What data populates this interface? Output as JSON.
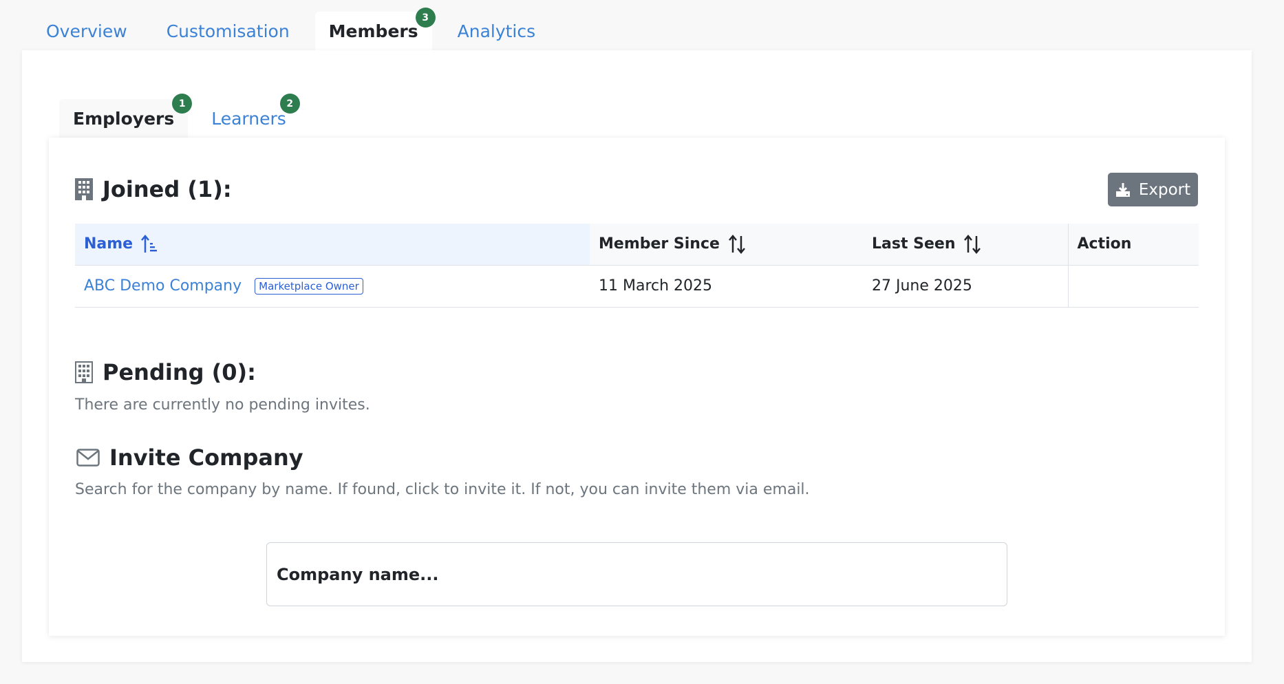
{
  "top_tabs": [
    {
      "label": "Overview"
    },
    {
      "label": "Customisation"
    },
    {
      "label": "Members",
      "badge": "3"
    },
    {
      "label": "Analytics"
    }
  ],
  "sub_tabs": [
    {
      "label": "Employers",
      "badge": "1"
    },
    {
      "label": "Learners",
      "badge": "2"
    }
  ],
  "joined": {
    "title": "Joined (1):",
    "export_label": "Export",
    "columns": [
      "Name",
      "Member Since",
      "Last Seen",
      "Action"
    ],
    "rows": [
      {
        "name": "ABC Demo Company",
        "tag": "Marketplace Owner",
        "member_since": "11 March 2025",
        "last_seen": "27 June 2025",
        "action": ""
      }
    ]
  },
  "pending": {
    "title": "Pending (0):",
    "message": "There are currently no pending invites."
  },
  "invite": {
    "title": "Invite Company",
    "description": "Search for the company by name. If found, click to invite it. If not, you can invite them via email.",
    "placeholder": "Company name..."
  },
  "colors": {
    "link": "#3b82d6",
    "badge": "#2e7d4f",
    "sorted_header": "#2b5fd3",
    "export_button": "#6c757d"
  },
  "icons": {
    "joined": "building-fill-icon",
    "pending": "building-outline-icon",
    "invite": "envelope-icon",
    "export": "download-icon",
    "name_sort": "sort-alpha-up-icon",
    "column_sort": "sort-up-down-icon"
  }
}
